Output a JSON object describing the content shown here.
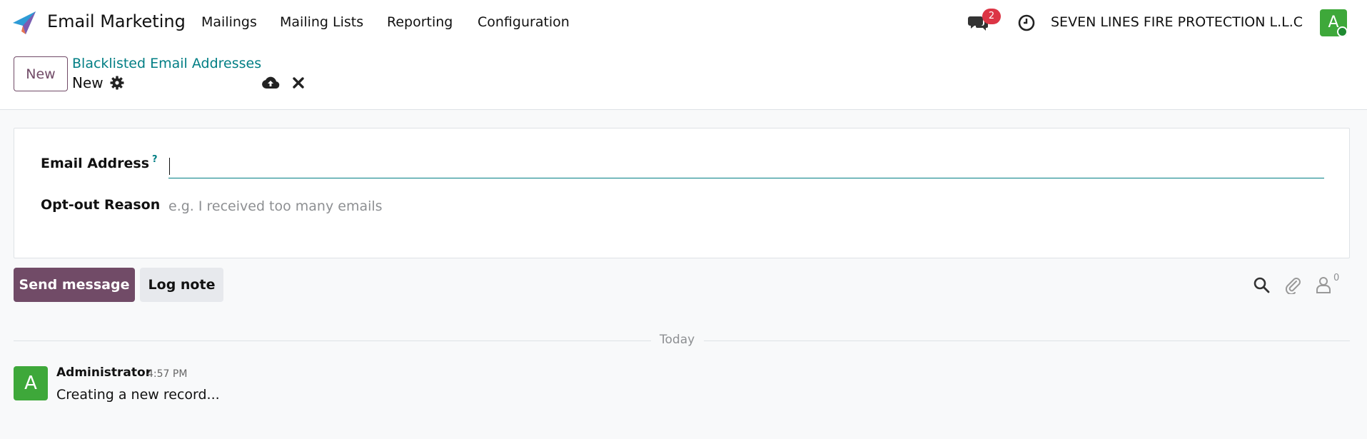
{
  "navbar": {
    "app_name": "Email Marketing",
    "menus": [
      "Mailings",
      "Mailing Lists",
      "Reporting",
      "Configuration"
    ],
    "chat_badge": "2",
    "company": "SEVEN LINES FIRE PROTECTION L.L.C",
    "avatar_letter": "A"
  },
  "control": {
    "new_label": "New",
    "breadcrumb": "Blacklisted Email Addresses",
    "record_name": "New"
  },
  "form": {
    "email_label": "Email Address",
    "email_help": "?",
    "email_value": "",
    "reason_label": "Opt-out Reason",
    "reason_placeholder": "e.g. I received too many emails"
  },
  "chatter": {
    "send_label": "Send message",
    "log_label": "Log note",
    "followers_count": "0",
    "divider": "Today",
    "messages": [
      {
        "avatar_letter": "A",
        "author": "Administrator",
        "time": "4:57 PM",
        "body": "Creating a new record..."
      }
    ]
  },
  "colors": {
    "brand": "#714b67",
    "link": "#017e84",
    "badge": "#dc3545",
    "avatar": "#3ea83a"
  },
  "icons": [
    "app-logo-icon",
    "chat-icon",
    "clock-icon",
    "gear-icon",
    "cloud-upload-icon",
    "close-icon",
    "search-icon",
    "paperclip-icon",
    "follower-icon"
  ]
}
